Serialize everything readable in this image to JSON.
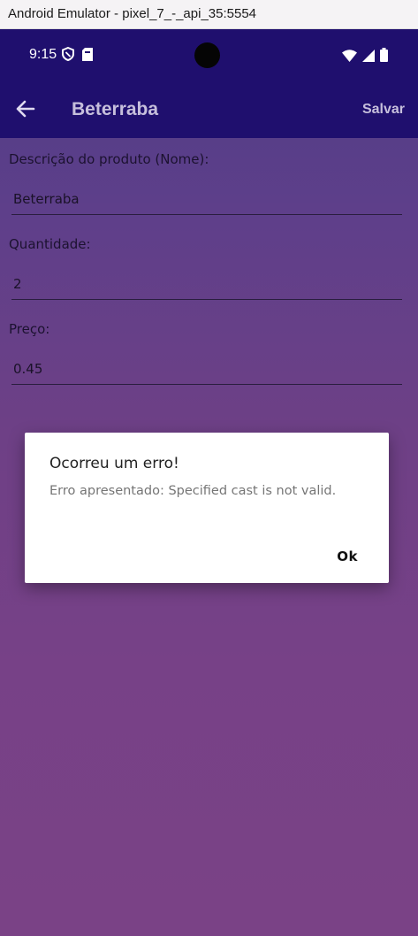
{
  "window": {
    "title": "Android Emulator - pixel_7_-_api_35:5554"
  },
  "statusbar": {
    "time": "9:15",
    "icons": [
      "shield-icon",
      "sim-card-icon",
      "wifi-icon",
      "signal-icon",
      "battery-icon"
    ]
  },
  "appbar": {
    "title": "Beterraba",
    "save_label": "Salvar",
    "back_icon": "arrow-back-icon"
  },
  "form": {
    "fields": [
      {
        "label": "Descrição do produto (Nome):",
        "value": "Beterraba"
      },
      {
        "label": "Quantidade:",
        "value": "2"
      },
      {
        "label": "Preço:",
        "value": "0.45"
      }
    ]
  },
  "dialog": {
    "title": "Ocorreu um erro!",
    "message": "Erro apresentado: Specified cast is not valid.",
    "ok_label": "Ok"
  },
  "colors": {
    "appbar": "#1f0f6e",
    "background_top": "#4e3d86",
    "background_bottom": "#7a4286"
  }
}
